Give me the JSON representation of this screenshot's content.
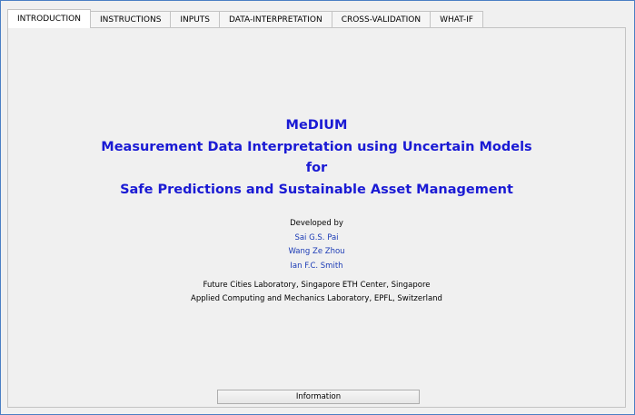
{
  "tabs": [
    {
      "label": "INTRODUCTION",
      "active": true
    },
    {
      "label": "INSTRUCTIONS",
      "active": false
    },
    {
      "label": "INPUTS",
      "active": false
    },
    {
      "label": "DATA-INTERPRETATION",
      "active": false
    },
    {
      "label": "CROSS-VALIDATION",
      "active": false
    },
    {
      "label": "WHAT-IF",
      "active": false
    }
  ],
  "intro": {
    "title_lines": [
      "MeDIUM",
      "Measurement Data Interpretation using Uncertain Models",
      "for",
      "Safe Predictions and Sustainable Asset Management"
    ],
    "developed_by": "Developed by",
    "authors": [
      "Sai G.S. Pai",
      "Wang Ze Zhou",
      "Ian F.C. Smith"
    ],
    "affiliations": [
      "Future Cities Laboratory, Singapore ETH Center, Singapore",
      "Applied Computing and Mechanics Laboratory, EPFL, Switzerland"
    ],
    "info_button_label": "Information"
  },
  "colors": {
    "title": "#1a1ad4",
    "author": "#1a3ab5",
    "window_border": "#4a7fc4",
    "panel_background": "#f0f0f0"
  }
}
